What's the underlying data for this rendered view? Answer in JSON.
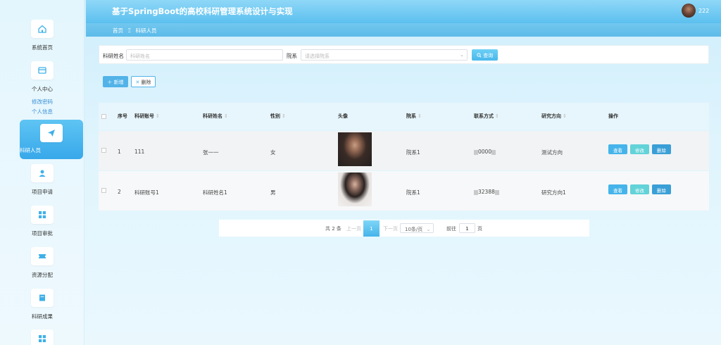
{
  "app": {
    "title": "基于SpringBoot的高校科研管理系统设计与实现",
    "username": "222"
  },
  "breadcrumb": {
    "home": "首页",
    "separator": "Ξ",
    "current": "科研人员"
  },
  "sidebar": {
    "items": [
      {
        "label": "系统首页",
        "icon": "home-icon"
      },
      {
        "label": "个人中心",
        "icon": "card-icon",
        "subs": [
          "修改密码",
          "个人信息"
        ]
      },
      {
        "label": "科研人员",
        "icon": "send-icon",
        "active": true
      },
      {
        "label": "项目申请",
        "icon": "user-icon"
      },
      {
        "label": "项目审批",
        "icon": "grid-icon"
      },
      {
        "label": "资源分配",
        "icon": "ticket-icon"
      },
      {
        "label": "科研成果",
        "icon": "doc-icon"
      }
    ]
  },
  "search": {
    "name_label": "科研姓名",
    "name_placeholder": "科研姓名",
    "dept_label": "院系",
    "dept_placeholder": "请选择院系",
    "query_button": "查询"
  },
  "toolbar": {
    "add_button": "新增",
    "delete_button": "删除"
  },
  "table": {
    "columns": [
      "序号",
      "科研账号",
      "科研姓名",
      "性别",
      "头像",
      "院系",
      "联系方式",
      "研究方向",
      "操作"
    ],
    "rows": [
      {
        "index": "1",
        "account": "111",
        "name": "张一一",
        "gender": "女",
        "dept": "院系1",
        "phone": "0000",
        "direction": "测试方向"
      },
      {
        "index": "2",
        "account": "科研账号1",
        "name": "科研姓名1",
        "gender": "男",
        "dept": "院系1",
        "phone": "32388",
        "direction": "研究方向1"
      }
    ],
    "actions": {
      "view": "查看",
      "edit": "修改",
      "remove": "删除"
    }
  },
  "pagination": {
    "total": "共 2 条",
    "prev": "上一页",
    "current_page": "1",
    "next": "下一页",
    "page_size": "10条/页",
    "goto_label": "前往",
    "goto_value": "1",
    "page_unit": "页"
  },
  "colors": {
    "accent": "#45b4ea",
    "header": "#5bc0ef",
    "edit": "#62d3d8"
  }
}
